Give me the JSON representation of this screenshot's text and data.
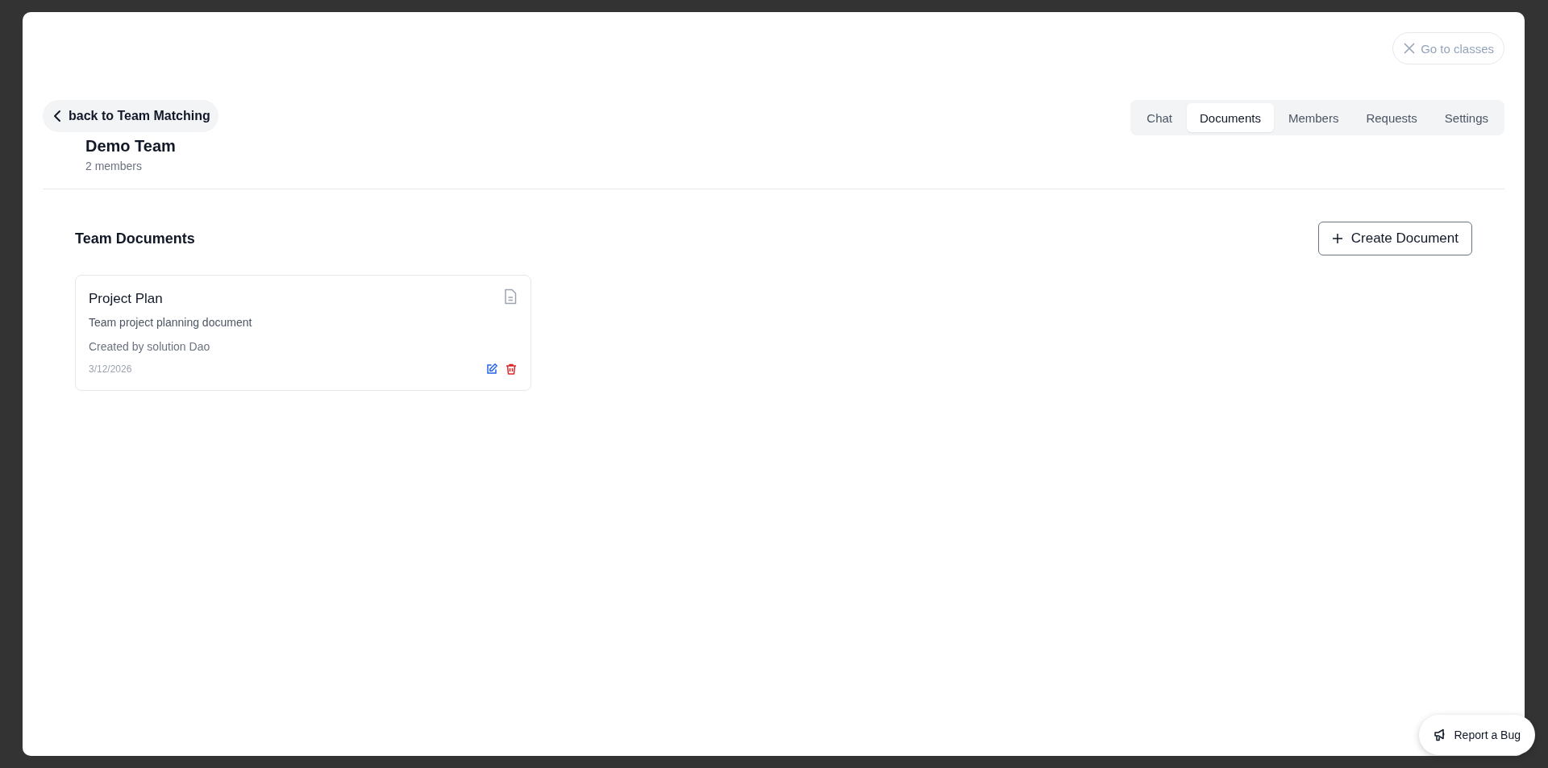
{
  "close_button": {
    "label": "Go to classes"
  },
  "back_button": {
    "label": "back to Team Matching"
  },
  "team": {
    "name": "Demo Team",
    "members": "2 members"
  },
  "tabs": [
    {
      "label": "Chat",
      "selected": false
    },
    {
      "label": "Documents",
      "selected": true
    },
    {
      "label": "Members",
      "selected": false
    },
    {
      "label": "Requests",
      "selected": false
    },
    {
      "label": "Settings",
      "selected": false
    }
  ],
  "section": {
    "title": "Team Documents",
    "create_button": "Create Document"
  },
  "documents": [
    {
      "title": "Project Plan",
      "description": "Team project planning document",
      "created_by": "Created by solution Dao",
      "date": "3/12/2026"
    }
  ],
  "report_button": {
    "label": "Report a Bug"
  }
}
